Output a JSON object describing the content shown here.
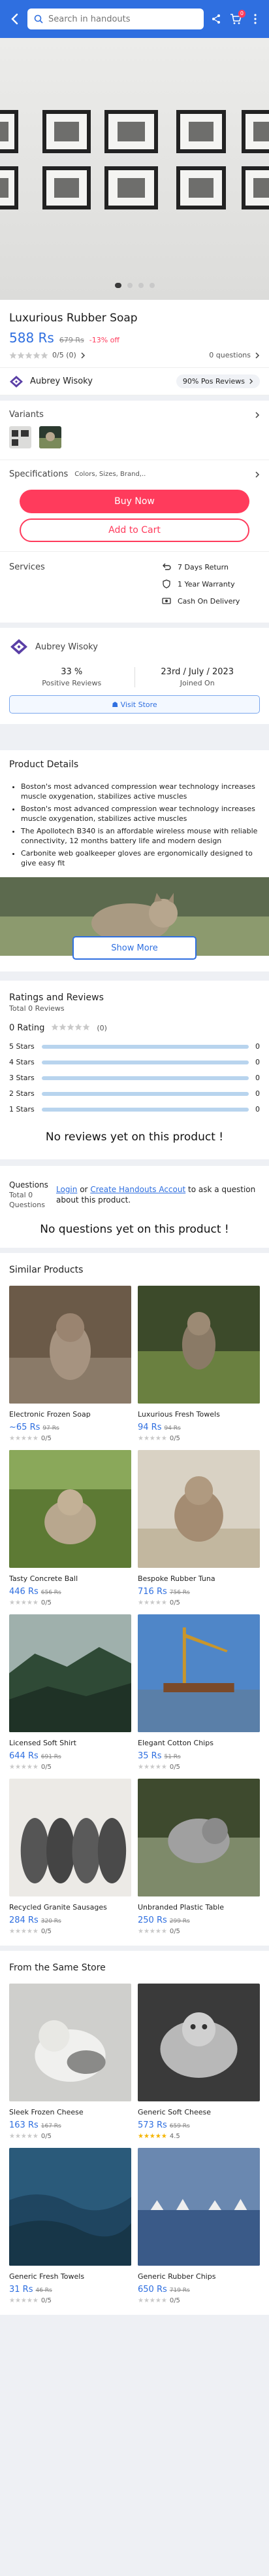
{
  "header": {
    "search_placeholder": "Search in handouts",
    "cart_count": "0"
  },
  "gallery": {
    "slide_count": 4,
    "active_slide": 1
  },
  "product": {
    "title": "Luxurious Rubber Soap",
    "price": "588 Rs",
    "old_price": "679 Rs",
    "discount": "-13% off",
    "rating_count": "0/5 (0)",
    "questions": "0 questions"
  },
  "seller": {
    "name": "Aubrey Wisoky",
    "positive": "90% Pos Reviews"
  },
  "variants": {
    "title": "Variants"
  },
  "specs": {
    "title": "Specifications",
    "summary": "Colors, Sizes, Brand,.."
  },
  "actions": {
    "buy_now": "Buy Now",
    "add_to_cart": "Add to Cart"
  },
  "services": {
    "title": "Services",
    "items": [
      "7 Days Return",
      "1 Year Warranty",
      "Cash On Delivery"
    ]
  },
  "store": {
    "name": "Aubrey Wisoky",
    "positive_value": "33 %",
    "positive_label": "Positive Reviews",
    "joined_value": "23rd / July / 2023",
    "joined_label": "Joined On",
    "visit": "Visit Store"
  },
  "details": {
    "title": "Product Details",
    "bullets": [
      "Boston's most advanced compression wear technology increases muscle oxygenation, stabilizes active muscles",
      "Boston's most advanced compression wear technology increases muscle oxygenation, stabilizes active muscles",
      "The Apollotech B340 is an affordable wireless mouse with reliable connectivity, 12 months battery life and modern design",
      "Carbonite web goalkeeper gloves are ergonomically designed to give easy fit"
    ],
    "show_more": "Show More"
  },
  "reviews": {
    "title": "Ratings and Reviews",
    "total": "Total 0 Reviews",
    "rating_label": "0 Rating",
    "rating_count": "(0)",
    "breakdown": [
      {
        "label": "5 Stars",
        "count": "0"
      },
      {
        "label": "4 Stars",
        "count": "0"
      },
      {
        "label": "3 Stars",
        "count": "0"
      },
      {
        "label": "2 Stars",
        "count": "0"
      },
      {
        "label": "1 Stars",
        "count": "0"
      }
    ],
    "empty": "No reviews yet on this product !"
  },
  "qa": {
    "title": "Questions",
    "total": "Total 0",
    "sub": "Questions",
    "login": "Login",
    "or": "or",
    "create": "Create Handouts Accout",
    "tail": "to ask a question about this product.",
    "empty": "No questions yet on this product !"
  },
  "similar": {
    "title": "Similar Products",
    "items": [
      {
        "name": "Electronic Frozen Soap",
        "price": "~65 Rs",
        "old": "97 Rs",
        "rating": "0/5"
      },
      {
        "name": "Luxurious Fresh Towels",
        "price": "94 Rs",
        "old": "94 Rs",
        "rating": "0/5"
      },
      {
        "name": "Tasty Concrete Ball",
        "price": "446 Rs",
        "old": "656 Rs",
        "rating": "0/5"
      },
      {
        "name": "Bespoke Rubber Tuna",
        "price": "716 Rs",
        "old": "756 Rs",
        "rating": "0/5"
      },
      {
        "name": "Licensed Soft Shirt",
        "price": "644 Rs",
        "old": "691 Rs",
        "rating": "0/5"
      },
      {
        "name": "Elegant Cotton Chips",
        "price": "35 Rs",
        "old": "51 Rs",
        "rating": "0/5"
      },
      {
        "name": "Recycled Granite Sausages",
        "price": "284 Rs",
        "old": "320 Rs",
        "rating": "0/5"
      },
      {
        "name": "Unbranded Plastic Table",
        "price": "250 Rs",
        "old": "299 Rs",
        "rating": "0/5"
      }
    ]
  },
  "same_store": {
    "title": "From the Same Store",
    "items": [
      {
        "name": "Sleek Frozen Cheese",
        "price": "163 Rs",
        "old": "167 Rs",
        "rating": "0/5"
      },
      {
        "name": "Generic Soft Cheese",
        "price": "573 Rs",
        "old": "659 Rs",
        "rating": "4.5"
      },
      {
        "name": "Generic Fresh Towels",
        "price": "31 Rs",
        "old": "46 Rs",
        "rating": "0/5"
      },
      {
        "name": "Generic Rubber Chips",
        "price": "650 Rs",
        "old": "719 Rs",
        "rating": "0/5"
      }
    ]
  },
  "colors": {
    "primary": "#2f6fe0",
    "accent": "#ff3b5c",
    "star": "#f5b400"
  }
}
